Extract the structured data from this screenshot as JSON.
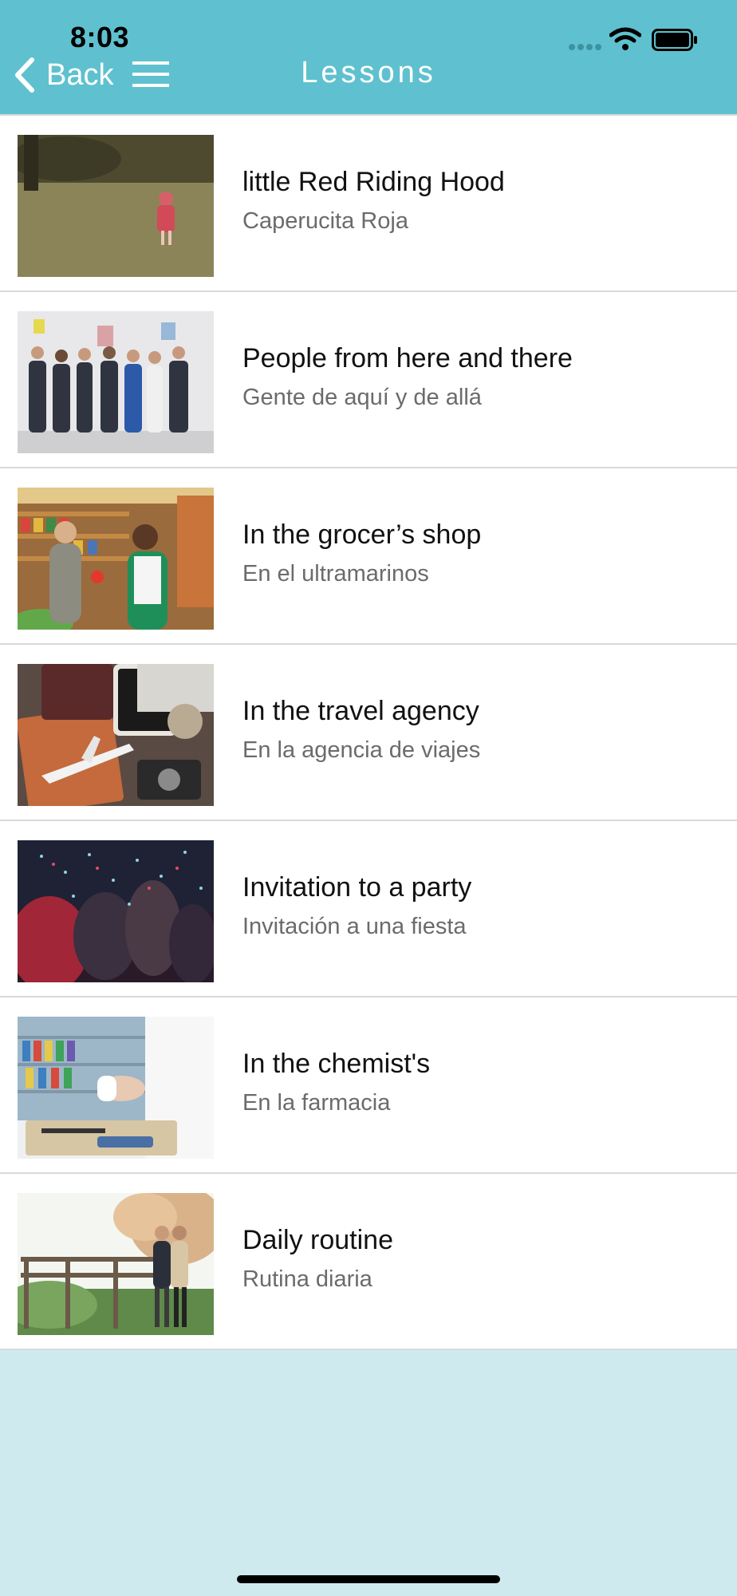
{
  "status_bar": {
    "time": "8:03"
  },
  "header": {
    "back_label": "Back",
    "title": "Lessons",
    "background_color": "#5fc1cf"
  },
  "lessons": [
    {
      "title": "little Red Riding Hood",
      "subtitle": "Caperucita Roja"
    },
    {
      "title": "People from here and there",
      "subtitle": "Gente de aquí y de allá"
    },
    {
      "title": "In the grocer’s shop",
      "subtitle": "En el ultramarinos"
    },
    {
      "title": "In the travel agency",
      "subtitle": "En la agencia de viajes"
    },
    {
      "title": "Invitation to a party",
      "subtitle": "Invitación a una fiesta"
    },
    {
      "title": "In the chemist's",
      "subtitle": "En la farmacia"
    },
    {
      "title": "Daily routine",
      "subtitle": "Rutina diaria"
    }
  ],
  "icons": [
    "back-chevron-icon",
    "menu-icon",
    "wifi-icon",
    "battery-icon",
    "signal-icon"
  ]
}
